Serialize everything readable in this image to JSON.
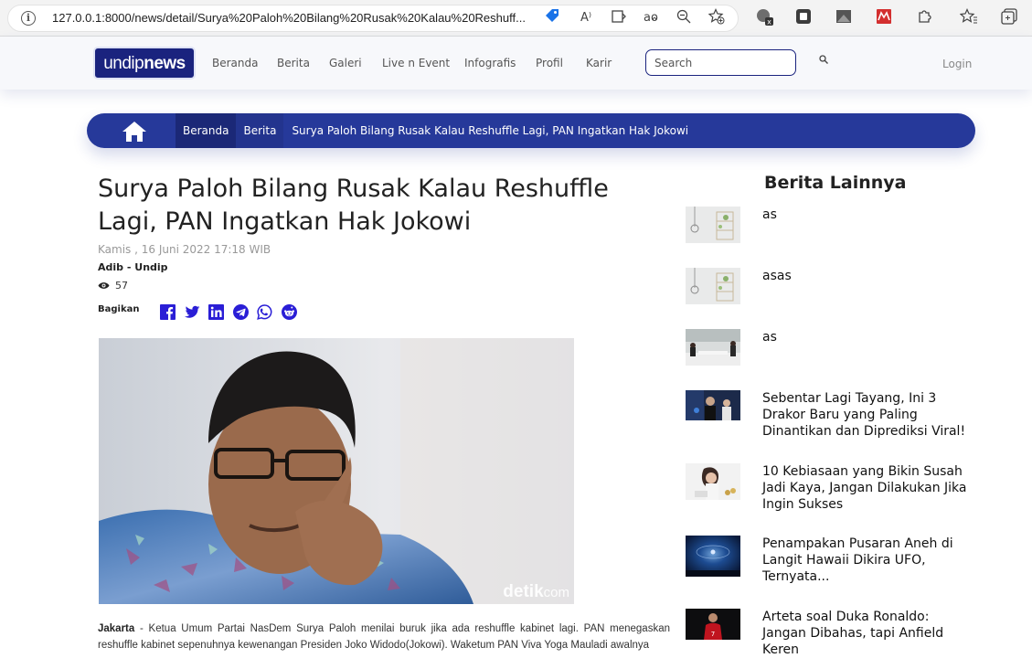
{
  "browser": {
    "url": "127.0.0.1:8000/news/detail/Surya%20Paloh%20Bilang%20Rusak%20Kalau%20Reshuff..."
  },
  "header": {
    "logo_left": "undip",
    "logo_right": "news",
    "nav": [
      "Beranda",
      "Berita",
      "Galeri",
      "Live n Event",
      "Infografis",
      "Profil",
      "Karir"
    ],
    "search_placeholder": "Search",
    "login": "Login"
  },
  "breadcrumb": {
    "items": [
      "Beranda",
      "Berita"
    ],
    "current": "Surya Paloh Bilang Rusak Kalau Reshuffle Lagi, PAN Ingatkan Hak Jokowi"
  },
  "article": {
    "title": "Surya Paloh Bilang Rusak Kalau Reshuffle Lagi, PAN Ingatkan Hak Jokowi",
    "date": "Kamis , 16 Juni 2022 17:18 WIB",
    "author": "Adib - Undip",
    "views": "57",
    "share_label": "Bagikan",
    "share_icons": [
      "facebook-icon",
      "twitter-icon",
      "linkedin-icon",
      "telegram-icon",
      "whatsapp-icon",
      "reddit-icon"
    ],
    "image_watermark_main": "detik",
    "image_watermark_sub": "com",
    "body_lead": "Jakarta",
    "body_text": " - Ketua Umum Partai NasDem Surya Paloh menilai buruk jika ada reshuffle kabinet lagi. PAN menegaskan reshuffle kabinet sepenuhnya kewenangan Presiden Joko Widodo(Jokowi). Waketum PAN Viva Yoga Mauladi awalnya"
  },
  "sidebar": {
    "title": "Berita Lainnya",
    "items": [
      {
        "title": "as"
      },
      {
        "title": "asas"
      },
      {
        "title": "as"
      },
      {
        "title": "Sebentar Lagi Tayang, Ini 3 Drakor Baru yang Paling Dinantikan dan Diprediksi Viral!"
      },
      {
        "title": "10 Kebiasaan yang Bikin Susah Jadi Kaya, Jangan Dilakukan Jika Ingin Sukses"
      },
      {
        "title": "Penampakan Pusaran Aneh di Langit Hawaii Dikira UFO, Ternyata..."
      },
      {
        "title": "Arteta soal Duka Ronaldo: Jangan Dibahas, tapi Anfield Keren"
      }
    ]
  },
  "colors": {
    "brand": "#1a237e",
    "breadcrumb_bg": "#26399a",
    "share_icon": "#2a1ed6"
  }
}
